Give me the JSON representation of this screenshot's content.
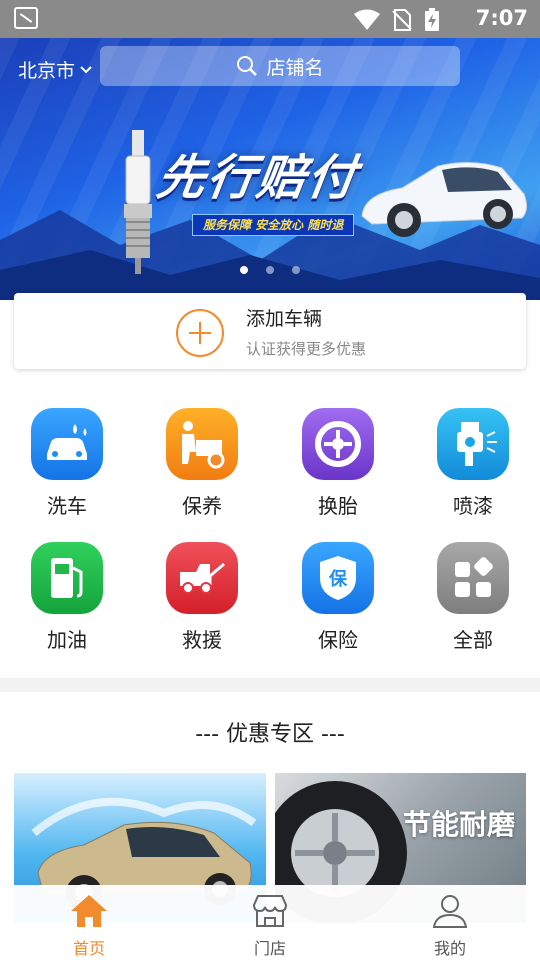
{
  "status_bar": {
    "time": "7:07"
  },
  "header": {
    "city": "北京市",
    "search_placeholder": "店铺名"
  },
  "banner": {
    "title": "先行赔付",
    "tagline": "服务保障  安全放心  随时退",
    "slide_count": 3,
    "active_slide": 0
  },
  "add_vehicle": {
    "title": "添加车辆",
    "subtitle": "认证获得更多优惠"
  },
  "services": [
    {
      "label": "洗车",
      "icon": "car-wash-icon",
      "color": "#1e8ff0"
    },
    {
      "label": "保养",
      "icon": "maintenance-icon",
      "color": "#f7941d"
    },
    {
      "label": "换胎",
      "icon": "tire-icon",
      "color": "#8a4fd8"
    },
    {
      "label": "喷漆",
      "icon": "spray-paint-icon",
      "color": "#1ba6e8"
    },
    {
      "label": "加油",
      "icon": "fuel-icon",
      "color": "#22b84a"
    },
    {
      "label": "救援",
      "icon": "rescue-truck-icon",
      "color": "#e8333c"
    },
    {
      "label": "保险",
      "icon": "insurance-icon",
      "color": "#1e8ff0"
    },
    {
      "label": "全部",
      "icon": "all-grid-icon",
      "color": "#8e8e8e"
    }
  ],
  "promo": {
    "title": "--- 优惠专区 ---",
    "right_card_text": "节能耐磨"
  },
  "tabs": [
    {
      "label": "首页",
      "icon": "home-icon",
      "active": true
    },
    {
      "label": "门店",
      "icon": "store-icon",
      "active": false
    },
    {
      "label": "我的",
      "icon": "user-icon",
      "active": false
    }
  ],
  "colors": {
    "accent": "#f28a2e",
    "banner_blue": "#1f63e6"
  }
}
